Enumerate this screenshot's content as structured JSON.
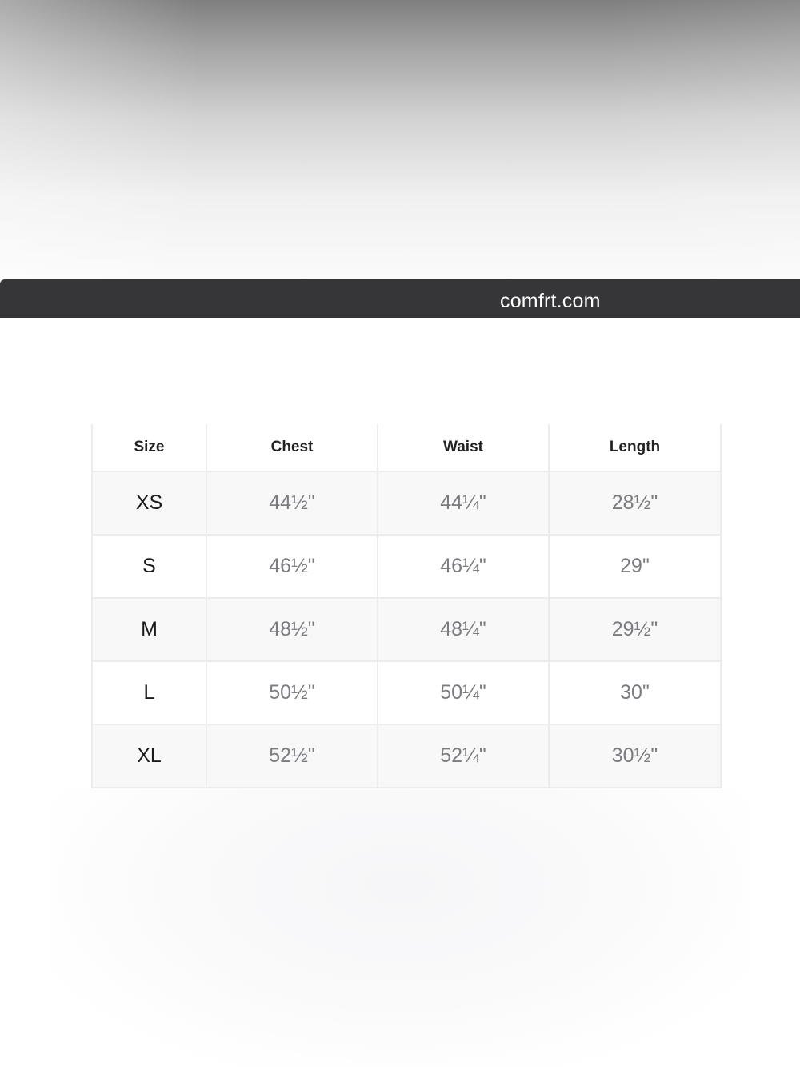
{
  "browser": {
    "url": "comfrt.com"
  },
  "size_chart": {
    "headers": [
      "Size",
      "Chest",
      "Waist",
      "Length"
    ],
    "rows": [
      {
        "size": "XS",
        "chest": "44½\"",
        "waist": "44¼\"",
        "length": "28½\""
      },
      {
        "size": "S",
        "chest": "46½\"",
        "waist": "46¼\"",
        "length": "29\""
      },
      {
        "size": "M",
        "chest": "48½\"",
        "waist": "48¼\"",
        "length": "29½\""
      },
      {
        "size": "L",
        "chest": "50½\"",
        "waist": "50¼\"",
        "length": "30\""
      },
      {
        "size": "XL",
        "chest": "52½\"",
        "waist": "52¼\"",
        "length": "30½\""
      }
    ]
  }
}
